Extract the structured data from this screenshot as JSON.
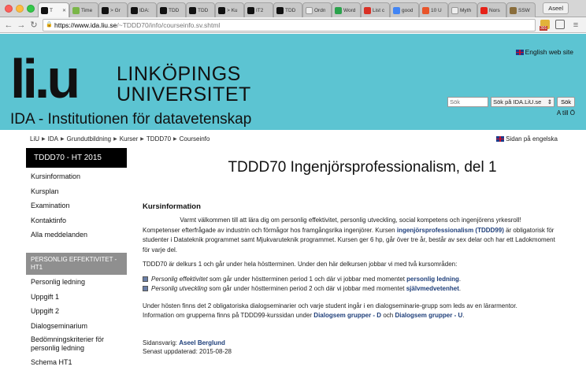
{
  "browser": {
    "tabs": [
      {
        "label": "T"
      },
      {
        "label": "Time"
      },
      {
        "label": "> Gr"
      },
      {
        "label": "IDA:"
      },
      {
        "label": "TDD"
      },
      {
        "label": "TDD"
      },
      {
        "label": "> Ku"
      },
      {
        "label": "IT2"
      },
      {
        "label": "TDD"
      },
      {
        "label": "Ordn"
      },
      {
        "label": "Word"
      },
      {
        "label": "List c"
      },
      {
        "label": "good"
      },
      {
        "label": "10 U"
      },
      {
        "label": "Myth"
      },
      {
        "label": "Nors"
      },
      {
        "label": "SSW"
      }
    ],
    "profile": "Aseel",
    "url_host": "https://www.ida.liu.se",
    "url_path": "/~TDDD70/info/courseinfo.sv.shtml",
    "extension_badge": "301"
  },
  "header": {
    "logo_text": "li.u",
    "university_line1": "LINKÖPINGS",
    "university_line2": "UNIVERSITET",
    "department": "IDA - Institutionen för datavetenskap",
    "english_link": "English web site",
    "search_placeholder": "Sök",
    "search_scope": "Sök på IDA.LiU.se",
    "search_button": "Sök",
    "a_to_o": "A till Ö"
  },
  "breadcrumb": [
    "LiU",
    "IDA",
    "Grundutbildning",
    "Kurser",
    "TDDD70",
    "Courseinfo"
  ],
  "swedish_link": "Sidan på engelska",
  "sidebar": {
    "course": "TDDD70 - HT 2015",
    "items": [
      "Kursinformation",
      "Kursplan",
      "Examination",
      "Kontaktinfo",
      "Alla meddelanden"
    ],
    "section": "PERSONLIG EFFEKTIVITET - HT1",
    "sub_items": [
      "Personlig ledning",
      "Uppgift 1",
      "Uppgift 2",
      "Dialogseminarium"
    ],
    "sub_item_long": "Bedömningskriterier för personlig ledning",
    "sub_item_last": "Schema HT1"
  },
  "main": {
    "title": "TDDD70 Ingenjörsprofessionalism, del 1",
    "section_heading": "Kursinformation",
    "intro_1": "Varmt välkommen till att lära dig om personlig effektivitet, personlig utveckling, social kompetens och ingenjörens yrkesroll!",
    "intro_2a": "Kompetenser efterfrågade av industrin och förmågor hos framgångsrika ingenjörer. Kursen ",
    "intro_2_link": "ingenjörsprofessionalism (TDDD99)",
    "intro_2b": " är obligatorisk för studenter i Datateknik programmet samt Mjukvaruteknik programmet. Kursen ger 6 hp, går över tre år, består av sex delar och har ett Ladokmoment för varje del.",
    "part_text": "TDDD70 är delkurs 1 och går under hela höstterminen. Under den här delkursen jobbar vi med två kursområden:",
    "bullet_1_em": "Personlig effektivitet",
    "bullet_1_text": " som går under höstterminen period 1 och där vi jobbar med momentet ",
    "bullet_1_link": "personlig ledning",
    "bullet_2_em": "Personlig utveckling",
    "bullet_2_text": " som går under höstterminen period 2 och där vi jobbar med momentet ",
    "bullet_2_link": "självmedvetenhet",
    "seminar_text": "Under hösten finns det 2 obligatoriska dialogseminarier och varje student ingår i en dialogseminarie-grupp som leds av en lärarmentor.",
    "seminar_text_2": "Information om grupperna finns på TDDD99-kurssidan under ",
    "seminar_link_d": "Dialogsem grupper - D",
    "seminar_and": " och ",
    "seminar_link_u": "Dialogsem grupper - U",
    "responsible_label": "Sidansvarig: ",
    "responsible_name": "Aseel Berglund",
    "updated": "Senast uppdaterad: 2015-08-28"
  },
  "colors": {
    "header_bg": "#5cc4d2",
    "link": "#1f3f7a",
    "sidebar_active": "#000000",
    "sidebar_section": "#8f8f8f"
  }
}
